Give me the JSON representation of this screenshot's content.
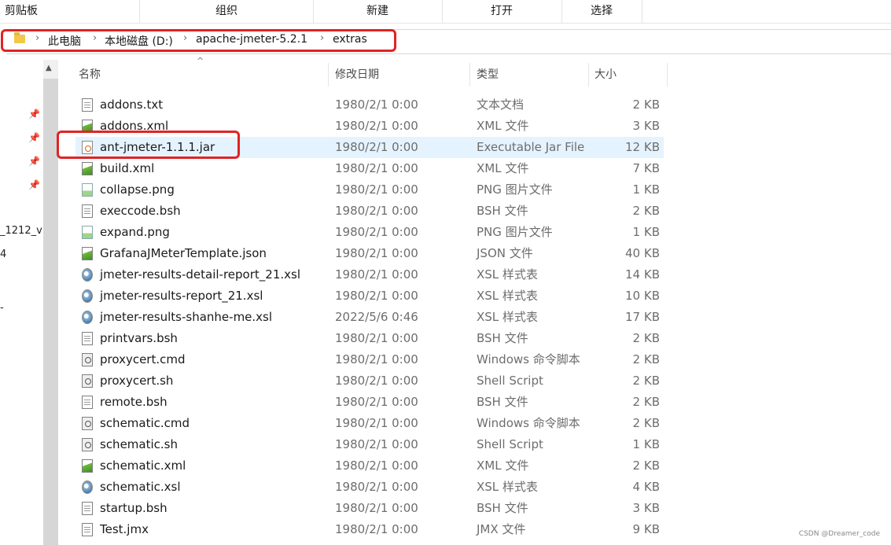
{
  "ribbon": {
    "groups": [
      "剪贴板",
      "组织",
      "新建",
      "打开",
      "选择"
    ]
  },
  "address": {
    "crumbs": [
      "此电脑",
      "本地磁盘 (D:)",
      "apache-jmeter-5.2.1",
      "extras"
    ],
    "separator": "›"
  },
  "nav": {
    "texts": [
      "_1212_v",
      "4",
      "-"
    ]
  },
  "columns": {
    "name": "名称",
    "date": "修改日期",
    "type": "类型",
    "size": "大小"
  },
  "files": [
    {
      "name": "addons.txt",
      "date": "1980/2/1 0:00",
      "type": "文本文档",
      "size": "2 KB",
      "icon": "text-file-icon"
    },
    {
      "name": "addons.xml",
      "date": "1980/2/1 0:00",
      "type": "XML 文件",
      "size": "3 KB",
      "icon": "xml-file-icon"
    },
    {
      "name": "ant-jmeter-1.1.1.jar",
      "date": "1980/2/1 0:00",
      "type": "Executable Jar File",
      "size": "12 KB",
      "icon": "jar-file-icon",
      "selected": true
    },
    {
      "name": "build.xml",
      "date": "1980/2/1 0:00",
      "type": "XML 文件",
      "size": "7 KB",
      "icon": "xml-file-icon"
    },
    {
      "name": "collapse.png",
      "date": "1980/2/1 0:00",
      "type": "PNG 图片文件",
      "size": "1 KB",
      "icon": "png-file-icon"
    },
    {
      "name": "execcode.bsh",
      "date": "1980/2/1 0:00",
      "type": "BSH 文件",
      "size": "2 KB",
      "icon": "blank-file-icon"
    },
    {
      "name": "expand.png",
      "date": "1980/2/1 0:00",
      "type": "PNG 图片文件",
      "size": "1 KB",
      "icon": "png-file-icon"
    },
    {
      "name": "GrafanaJMeterTemplate.json",
      "date": "1980/2/1 0:00",
      "type": "JSON 文件",
      "size": "40 KB",
      "icon": "xml-file-icon"
    },
    {
      "name": "jmeter-results-detail-report_21.xsl",
      "date": "1980/2/1 0:00",
      "type": "XSL 样式表",
      "size": "14 KB",
      "icon": "xsl-file-icon"
    },
    {
      "name": "jmeter-results-report_21.xsl",
      "date": "1980/2/1 0:00",
      "type": "XSL 样式表",
      "size": "10 KB",
      "icon": "xsl-file-icon"
    },
    {
      "name": "jmeter-results-shanhe-me.xsl",
      "date": "2022/5/6 0:46",
      "type": "XSL 样式表",
      "size": "17 KB",
      "icon": "xsl-file-icon"
    },
    {
      "name": "printvars.bsh",
      "date": "1980/2/1 0:00",
      "type": "BSH 文件",
      "size": "2 KB",
      "icon": "blank-file-icon"
    },
    {
      "name": "proxycert.cmd",
      "date": "1980/2/1 0:00",
      "type": "Windows 命令脚本",
      "size": "2 KB",
      "icon": "script-file-icon"
    },
    {
      "name": "proxycert.sh",
      "date": "1980/2/1 0:00",
      "type": "Shell Script",
      "size": "2 KB",
      "icon": "script-file-icon"
    },
    {
      "name": "remote.bsh",
      "date": "1980/2/1 0:00",
      "type": "BSH 文件",
      "size": "2 KB",
      "icon": "blank-file-icon"
    },
    {
      "name": "schematic.cmd",
      "date": "1980/2/1 0:00",
      "type": "Windows 命令脚本",
      "size": "2 KB",
      "icon": "script-file-icon"
    },
    {
      "name": "schematic.sh",
      "date": "1980/2/1 0:00",
      "type": "Shell Script",
      "size": "1 KB",
      "icon": "script-file-icon"
    },
    {
      "name": "schematic.xml",
      "date": "1980/2/1 0:00",
      "type": "XML 文件",
      "size": "2 KB",
      "icon": "xml-file-icon"
    },
    {
      "name": "schematic.xsl",
      "date": "1980/2/1 0:00",
      "type": "XSL 样式表",
      "size": "4 KB",
      "icon": "xsl-file-icon"
    },
    {
      "name": "startup.bsh",
      "date": "1980/2/1 0:00",
      "type": "BSH 文件",
      "size": "3 KB",
      "icon": "blank-file-icon"
    },
    {
      "name": "Test.jmx",
      "date": "1980/2/1 0:00",
      "type": "JMX 文件",
      "size": "9 KB",
      "icon": "blank-file-icon"
    }
  ],
  "watermark": "CSDN @Dreamer_code"
}
